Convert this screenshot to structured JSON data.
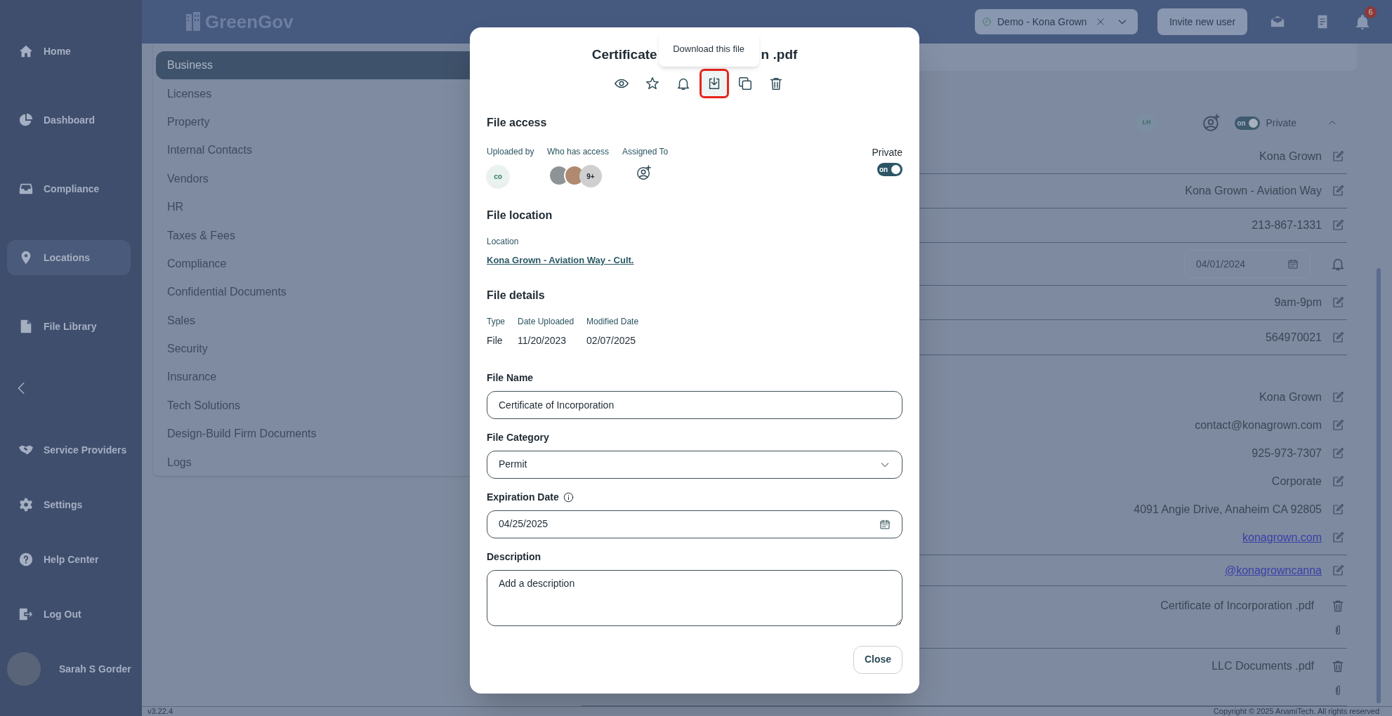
{
  "top_bar": {
    "logo": "GreenGov",
    "location_selector": "Demo - Kona Grown",
    "invite_button": "Invite new user",
    "notification_count": "6"
  },
  "sidebar": {
    "main_items": [
      {
        "label": "Home",
        "selected": false
      },
      {
        "label": "Dashboard",
        "selected": false
      },
      {
        "label": "Compliance",
        "selected": false
      },
      {
        "label": "Locations",
        "selected": true
      },
      {
        "label": "File Library",
        "selected": false
      }
    ],
    "bottom_items": [
      {
        "label": "Service Providers"
      },
      {
        "label": "Settings"
      },
      {
        "label": "Help Center"
      },
      {
        "label": "Log Out"
      }
    ],
    "user": "Sarah S Gorder"
  },
  "categories": [
    {
      "label": "Business",
      "selected": true
    },
    {
      "label": "Licenses",
      "selected": false
    },
    {
      "label": "Property",
      "selected": false
    },
    {
      "label": "Internal Contacts",
      "selected": false
    },
    {
      "label": "Vendors",
      "selected": false
    },
    {
      "label": "HR",
      "selected": false
    },
    {
      "label": "Taxes & Fees",
      "selected": false
    },
    {
      "label": "Compliance",
      "selected": false
    },
    {
      "label": "Confidential Documents",
      "selected": false
    },
    {
      "label": "Sales",
      "selected": false
    },
    {
      "label": "Security",
      "selected": false
    },
    {
      "label": "Insurance",
      "selected": false
    },
    {
      "label": "Tech Solutions",
      "selected": false
    },
    {
      "label": "Design-Build Firm Documents",
      "selected": false
    },
    {
      "label": "Logs",
      "selected": false
    }
  ],
  "details": {
    "header": {
      "initials": "LH",
      "toggle_text": "on",
      "private_on": true,
      "private_label": "Private"
    },
    "blocks": [
      {
        "rows": [
          {
            "kind": "text",
            "value": "Kona Grown"
          }
        ]
      },
      {
        "rows": [
          {
            "kind": "text",
            "value": "Kona Grown - Aviation Way"
          }
        ]
      },
      {
        "rows": [
          {
            "kind": "text",
            "value": "213-867-1331"
          }
        ]
      },
      {
        "rows": [
          {
            "kind": "date",
            "value": "04/01/2024"
          }
        ]
      },
      {
        "rows": [
          {
            "kind": "text",
            "value": "9am-9pm"
          }
        ]
      },
      {
        "rows": [
          {
            "kind": "text",
            "value": "564970021"
          }
        ]
      },
      {
        "rows": [
          {
            "kind": "text",
            "value": "Kona Grown"
          },
          {
            "kind": "text",
            "value": "contact@konagrown.com"
          },
          {
            "kind": "text",
            "value": "925-973-7307"
          },
          {
            "kind": "text",
            "value": "Corporate"
          },
          {
            "kind": "text",
            "value": "4091 Angie Drive, Anaheim CA 92805"
          },
          {
            "kind": "link",
            "value": "konagrown.com"
          }
        ]
      },
      {
        "rows": [
          {
            "kind": "link",
            "value": "@konagrowncanna"
          }
        ]
      },
      {
        "rows": [
          {
            "kind": "file",
            "value": "Certificate of Incorporation .pdf"
          }
        ]
      },
      {
        "rows": [
          {
            "kind": "file",
            "value": "LLC Documents .pdf"
          }
        ]
      }
    ]
  },
  "modal": {
    "title_parts": [
      "Certificate",
      "n .pdf"
    ],
    "tooltip": "Download this file",
    "actions": [
      {
        "highlighted": false
      },
      {
        "highlighted": false
      },
      {
        "highlighted": false
      },
      {
        "highlighted": true
      },
      {
        "highlighted": false
      },
      {
        "highlighted": false
      }
    ],
    "file_access": {
      "heading": "File access",
      "uploaded_by_label": "Uploaded by",
      "uploader_initials": "co",
      "access_label": "Who has access",
      "access_more": "9+",
      "assigned_label": "Assigned To",
      "private_label": "Private",
      "toggle_text": "on",
      "private_on": true
    },
    "file_location": {
      "heading": "File location",
      "label": "Location",
      "link": "Kona Grown - Aviation Way - Cult."
    },
    "file_details": {
      "heading": "File details",
      "columns": [
        {
          "label": "Type",
          "value": "File"
        },
        {
          "label": "Date Uploaded",
          "value": "11/20/2023"
        },
        {
          "label": "Modified Date",
          "value": "02/07/2025"
        }
      ]
    },
    "file_name": {
      "label": "File Name",
      "value": "Certificate of Incorporation"
    },
    "file_category": {
      "label": "File Category",
      "value": "Permit"
    },
    "expiration_date": {
      "label": "Expiration Date",
      "value": "04/25/2025"
    },
    "description": {
      "label": "Description",
      "placeholder": "Add a description"
    },
    "close_button": "Close"
  },
  "footer": {
    "version": "v3.22.4",
    "copyright": "Copyright © 2025 AnamiTech. All rights reserved"
  }
}
